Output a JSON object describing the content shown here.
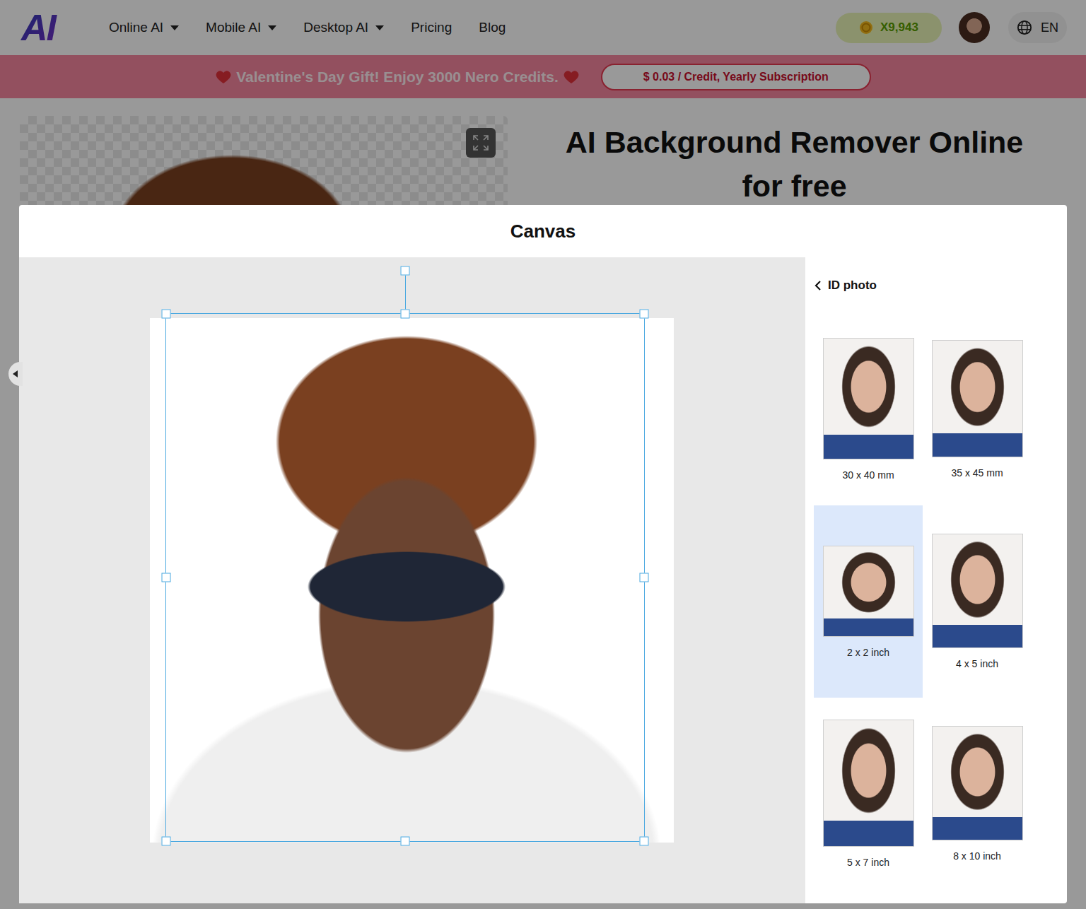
{
  "header": {
    "logo": "AI",
    "nav": [
      {
        "label": "Online AI",
        "dropdown": true
      },
      {
        "label": "Mobile AI",
        "dropdown": true
      },
      {
        "label": "Desktop AI",
        "dropdown": true
      },
      {
        "label": "Pricing",
        "dropdown": false
      },
      {
        "label": "Blog",
        "dropdown": false
      }
    ],
    "credits": "X9,943",
    "language": "EN"
  },
  "banner": {
    "text": "Valentine's Day Gift! Enjoy 3000 Nero Credits.",
    "button": "$ 0.03 / Credit, Yearly Subscription"
  },
  "page": {
    "title_lines": [
      "AI Background Remover Online",
      "for free"
    ]
  },
  "modal": {
    "title": "Canvas",
    "panel": {
      "back": "ID photo",
      "sizes": [
        {
          "label": "30 x 40 mm",
          "selected": false
        },
        {
          "label": "35 x 45 mm",
          "selected": false
        },
        {
          "label": "2 x 2 inch",
          "selected": true
        },
        {
          "label": "4 x 5 inch",
          "selected": false
        },
        {
          "label": "5 x 7 inch",
          "selected": false
        },
        {
          "label": "8 x 10 inch",
          "selected": false
        }
      ]
    }
  }
}
